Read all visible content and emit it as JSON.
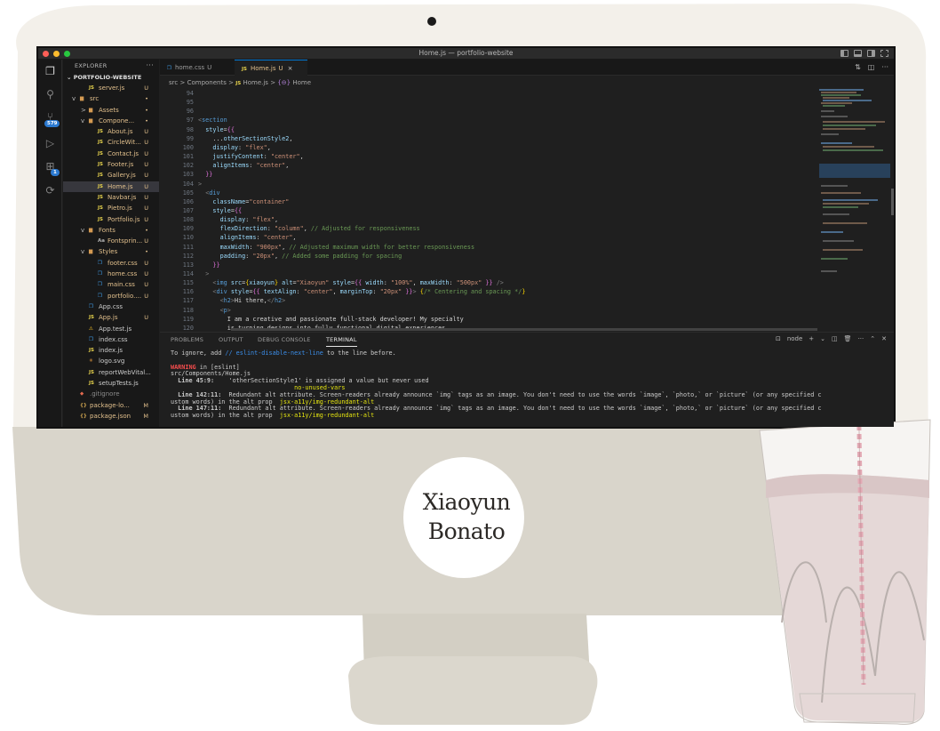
{
  "window": {
    "title": "Home.js — portfolio-website"
  },
  "sidebar": {
    "header": "EXPLORER",
    "more": "···",
    "project": "PORTFOLIO-WEBSITE",
    "activity_badges": {
      "source_control": "579",
      "extensions": "1"
    },
    "items": [
      {
        "chev": "",
        "type": "js",
        "name": "server.js",
        "status": "U",
        "indent": 1
      },
      {
        "chev": "v",
        "type": "folder",
        "name": "src",
        "status": "•",
        "indent": 0
      },
      {
        "chev": ">",
        "type": "folder",
        "name": "Assets",
        "status": "•",
        "indent": 1
      },
      {
        "chev": "v",
        "type": "folder",
        "name": "Compone...",
        "status": "•",
        "indent": 1
      },
      {
        "chev": "",
        "type": "js",
        "name": "About.js",
        "status": "U",
        "indent": 2
      },
      {
        "chev": "",
        "type": "js",
        "name": "CircleWit...",
        "status": "U",
        "indent": 2
      },
      {
        "chev": "",
        "type": "js",
        "name": "Contact.js",
        "status": "U",
        "indent": 2
      },
      {
        "chev": "",
        "type": "js",
        "name": "Footer.js",
        "status": "U",
        "indent": 2
      },
      {
        "chev": "",
        "type": "js",
        "name": "Gallery.js",
        "status": "U",
        "indent": 2
      },
      {
        "chev": "",
        "type": "js",
        "name": "Home.js",
        "status": "U",
        "indent": 2,
        "selected": true
      },
      {
        "chev": "",
        "type": "js",
        "name": "Navbar.js",
        "status": "U",
        "indent": 2
      },
      {
        "chev": "",
        "type": "js",
        "name": "Pietro.js",
        "status": "U",
        "indent": 2
      },
      {
        "chev": "",
        "type": "js",
        "name": "Portfolio.js",
        "status": "U",
        "indent": 2
      },
      {
        "chev": "v",
        "type": "folder",
        "name": "Fonts",
        "status": "•",
        "indent": 1
      },
      {
        "chev": "",
        "type": "font",
        "name": "Fontsprin...",
        "status": "U",
        "indent": 2
      },
      {
        "chev": "v",
        "type": "folder",
        "name": "Styles",
        "status": "•",
        "indent": 1
      },
      {
        "chev": "",
        "type": "css",
        "name": "footer.css",
        "status": "U",
        "indent": 2
      },
      {
        "chev": "",
        "type": "css",
        "name": "home.css",
        "status": "U",
        "indent": 2
      },
      {
        "chev": "",
        "type": "css",
        "name": "main.css",
        "status": "U",
        "indent": 2
      },
      {
        "chev": "",
        "type": "css",
        "name": "portfolio....",
        "status": "U",
        "indent": 2
      },
      {
        "chev": "",
        "type": "css",
        "name": "App.css",
        "status": "",
        "indent": 1
      },
      {
        "chev": "",
        "type": "js",
        "name": "App.js",
        "status": "U",
        "indent": 1
      },
      {
        "chev": "",
        "type": "test",
        "name": "App.test.js",
        "status": "",
        "indent": 1
      },
      {
        "chev": "",
        "type": "css",
        "name": "index.css",
        "status": "",
        "indent": 1
      },
      {
        "chev": "",
        "type": "js",
        "name": "index.js",
        "status": "",
        "indent": 1
      },
      {
        "chev": "",
        "type": "svg",
        "name": "logo.svg",
        "status": "",
        "indent": 1
      },
      {
        "chev": "",
        "type": "js",
        "name": "reportWebVital...",
        "status": "",
        "indent": 1
      },
      {
        "chev": "",
        "type": "js",
        "name": "setupTests.js",
        "status": "",
        "indent": 1
      },
      {
        "chev": "",
        "type": "git",
        "name": ".gitignore",
        "status": "",
        "indent": 0
      },
      {
        "chev": "",
        "type": "json",
        "name": "package-lo...",
        "status": "M",
        "indent": 0
      },
      {
        "chev": "",
        "type": "json",
        "name": "package.json",
        "status": "M",
        "indent": 0
      }
    ]
  },
  "tabs": [
    {
      "type": "CSS",
      "label": "home.css",
      "status": "U",
      "active": false
    },
    {
      "type": "JS",
      "label": "Home.js",
      "status": "U",
      "active": true,
      "close": "×"
    }
  ],
  "breadcrumb": {
    "parts": [
      "src",
      "Components",
      "Home.js",
      "Home"
    ],
    "sep": ">",
    "js_icon": "JS",
    "symbol_icon": "{⊖}"
  },
  "code_lines": [
    {
      "n": "94",
      "segs": []
    },
    {
      "n": "95",
      "segs": []
    },
    {
      "n": "96",
      "segs": []
    },
    {
      "n": "97",
      "segs": [
        [
          "tk-punc",
          "<"
        ],
        [
          "tk-tag",
          "section"
        ]
      ]
    },
    {
      "n": "98",
      "segs": [
        [
          "tk-txt",
          "  "
        ],
        [
          "tk-attr",
          "style"
        ],
        [
          "tk-txt",
          "="
        ],
        [
          "tk-brace",
          "{{"
        ]
      ]
    },
    {
      "n": "99",
      "segs": [
        [
          "tk-txt",
          "    ..."
        ],
        [
          "tk-var",
          "otherSectionStyle2"
        ],
        [
          "tk-txt",
          ","
        ]
      ]
    },
    {
      "n": "100",
      "segs": [
        [
          "tk-txt",
          "    "
        ],
        [
          "tk-var",
          "display"
        ],
        [
          "tk-txt",
          ": "
        ],
        [
          "tk-str",
          "\"flex\""
        ],
        [
          "tk-txt",
          ","
        ]
      ]
    },
    {
      "n": "101",
      "segs": [
        [
          "tk-txt",
          "    "
        ],
        [
          "tk-var",
          "justifyContent"
        ],
        [
          "tk-txt",
          ": "
        ],
        [
          "tk-str",
          "\"center\""
        ],
        [
          "tk-txt",
          ","
        ]
      ]
    },
    {
      "n": "102",
      "segs": [
        [
          "tk-txt",
          "    "
        ],
        [
          "tk-var",
          "alignItems"
        ],
        [
          "tk-txt",
          ": "
        ],
        [
          "tk-str",
          "\"center\""
        ],
        [
          "tk-txt",
          ","
        ]
      ]
    },
    {
      "n": "103",
      "segs": [
        [
          "tk-txt",
          "  "
        ],
        [
          "tk-brace",
          "}}"
        ]
      ]
    },
    {
      "n": "104",
      "segs": [
        [
          "tk-punc",
          ">"
        ]
      ]
    },
    {
      "n": "105",
      "segs": [
        [
          "tk-txt",
          "  "
        ],
        [
          "tk-punc",
          "<"
        ],
        [
          "tk-tag",
          "div"
        ]
      ]
    },
    {
      "n": "106",
      "segs": [
        [
          "tk-txt",
          "    "
        ],
        [
          "tk-attr",
          "className"
        ],
        [
          "tk-txt",
          "="
        ],
        [
          "tk-str",
          "\"container\""
        ]
      ]
    },
    {
      "n": "107",
      "segs": [
        [
          "tk-txt",
          "    "
        ],
        [
          "tk-attr",
          "style"
        ],
        [
          "tk-txt",
          "="
        ],
        [
          "tk-brace",
          "{{"
        ]
      ]
    },
    {
      "n": "108",
      "segs": [
        [
          "tk-txt",
          "      "
        ],
        [
          "tk-var",
          "display"
        ],
        [
          "tk-txt",
          ": "
        ],
        [
          "tk-str",
          "\"flex\""
        ],
        [
          "tk-txt",
          ","
        ]
      ]
    },
    {
      "n": "109",
      "segs": [
        [
          "tk-txt",
          "      "
        ],
        [
          "tk-var",
          "flexDirection"
        ],
        [
          "tk-txt",
          ": "
        ],
        [
          "tk-str",
          "\"column\""
        ],
        [
          "tk-txt",
          ", "
        ],
        [
          "tk-cmt",
          "// Adjusted for responsiveness"
        ]
      ]
    },
    {
      "n": "110",
      "segs": [
        [
          "tk-txt",
          "      "
        ],
        [
          "tk-var",
          "alignItems"
        ],
        [
          "tk-txt",
          ": "
        ],
        [
          "tk-str",
          "\"center\""
        ],
        [
          "tk-txt",
          ","
        ]
      ]
    },
    {
      "n": "111",
      "segs": [
        [
          "tk-txt",
          "      "
        ],
        [
          "tk-var",
          "maxWidth"
        ],
        [
          "tk-txt",
          ": "
        ],
        [
          "tk-str",
          "\"900px\""
        ],
        [
          "tk-txt",
          ", "
        ],
        [
          "tk-cmt",
          "// Adjusted maximum width for better responsiveness"
        ]
      ]
    },
    {
      "n": "112",
      "segs": [
        [
          "tk-txt",
          "      "
        ],
        [
          "tk-var",
          "padding"
        ],
        [
          "tk-txt",
          ": "
        ],
        [
          "tk-str",
          "\"20px\""
        ],
        [
          "tk-txt",
          ", "
        ],
        [
          "tk-cmt",
          "// Added some padding for spacing"
        ]
      ]
    },
    {
      "n": "113",
      "segs": [
        [
          "tk-txt",
          "    "
        ],
        [
          "tk-brace",
          "}}"
        ]
      ]
    },
    {
      "n": "114",
      "segs": [
        [
          "tk-txt",
          "  "
        ],
        [
          "tk-punc",
          ">"
        ]
      ]
    },
    {
      "n": "115",
      "segs": [
        [
          "tk-txt",
          "    "
        ],
        [
          "tk-punc",
          "<"
        ],
        [
          "tk-tag",
          "img"
        ],
        [
          "tk-txt",
          " "
        ],
        [
          "tk-attr",
          "src"
        ],
        [
          "tk-txt",
          "="
        ],
        [
          "tk-brace2",
          "{"
        ],
        [
          "tk-var",
          "xiaoyun"
        ],
        [
          "tk-brace2",
          "}"
        ],
        [
          "tk-txt",
          " "
        ],
        [
          "tk-attr",
          "alt"
        ],
        [
          "tk-txt",
          "="
        ],
        [
          "tk-str",
          "\"Xiaoyun\""
        ],
        [
          "tk-txt",
          " "
        ],
        [
          "tk-attr",
          "style"
        ],
        [
          "tk-txt",
          "="
        ],
        [
          "tk-brace",
          "{{"
        ],
        [
          "tk-txt",
          " "
        ],
        [
          "tk-var",
          "width"
        ],
        [
          "tk-txt",
          ": "
        ],
        [
          "tk-str",
          "\"100%\""
        ],
        [
          "tk-txt",
          ", "
        ],
        [
          "tk-var",
          "maxWidth"
        ],
        [
          "tk-txt",
          ": "
        ],
        [
          "tk-str",
          "\"500px\""
        ],
        [
          "tk-txt",
          " "
        ],
        [
          "tk-brace",
          "}}"
        ],
        [
          "tk-txt",
          " "
        ],
        [
          "tk-punc",
          "/>"
        ]
      ]
    },
    {
      "n": "116",
      "segs": [
        [
          "tk-txt",
          "    "
        ],
        [
          "tk-punc",
          "<"
        ],
        [
          "tk-tag",
          "div"
        ],
        [
          "tk-txt",
          " "
        ],
        [
          "tk-attr",
          "style"
        ],
        [
          "tk-txt",
          "="
        ],
        [
          "tk-brace",
          "{{"
        ],
        [
          "tk-txt",
          " "
        ],
        [
          "tk-var",
          "textAlign"
        ],
        [
          "tk-txt",
          ": "
        ],
        [
          "tk-str",
          "\"center\""
        ],
        [
          "tk-txt",
          ", "
        ],
        [
          "tk-var",
          "marginTop"
        ],
        [
          "tk-txt",
          ": "
        ],
        [
          "tk-str",
          "\"20px\""
        ],
        [
          "tk-txt",
          " "
        ],
        [
          "tk-brace",
          "}}"
        ],
        [
          "tk-punc",
          ">"
        ],
        [
          "tk-txt",
          " "
        ],
        [
          "tk-brace2",
          "{"
        ],
        [
          "tk-cmt",
          "/* Centering and spacing */"
        ],
        [
          "tk-brace2",
          "}"
        ]
      ]
    },
    {
      "n": "117",
      "segs": [
        [
          "tk-txt",
          "      "
        ],
        [
          "tk-punc",
          "<"
        ],
        [
          "tk-tag",
          "h2"
        ],
        [
          "tk-punc",
          ">"
        ],
        [
          "tk-txt",
          "Hi there,"
        ],
        [
          "tk-punc",
          "</"
        ],
        [
          "tk-tag",
          "h2"
        ],
        [
          "tk-punc",
          ">"
        ]
      ]
    },
    {
      "n": "118",
      "segs": [
        [
          "tk-txt",
          "      "
        ],
        [
          "tk-punc",
          "<"
        ],
        [
          "tk-tag",
          "p"
        ],
        [
          "tk-punc",
          ">"
        ]
      ]
    },
    {
      "n": "119",
      "segs": [
        [
          "tk-txt",
          "        I am a creative and passionate full-stack developer! My specialty"
        ]
      ]
    },
    {
      "n": "120",
      "segs": [
        [
          "tk-txt",
          "        is turning designs into fully functional digital experiences,"
        ]
      ]
    }
  ],
  "panel": {
    "tabs": [
      "PROBLEMS",
      "OUTPUT",
      "DEBUG CONSOLE",
      "TERMINAL"
    ],
    "active_tab": "TERMINAL",
    "shell": "node",
    "add": "+",
    "more": "···"
  },
  "terminal_lines": [
    [
      [
        "",
        "To ignore, add "
      ],
      [
        "t-blue",
        "// eslint-disable-next-line"
      ],
      [
        "",
        " to the line before."
      ]
    ],
    [
      [
        "",
        ""
      ]
    ],
    [
      [
        "t-warn",
        "WARNING"
      ],
      [
        "",
        " in [eslint]"
      ]
    ],
    [
      [
        "",
        "src/Components/Home.js"
      ]
    ],
    [
      [
        "t-bold",
        "  Line 45:9:"
      ],
      [
        "",
        "    'otherSectionStyle1' is assigned a value but never used"
      ]
    ],
    [
      [
        "",
        "                                  "
      ],
      [
        "t-yellow",
        "no-unused-vars"
      ]
    ],
    [
      [
        "t-bold",
        "  Line 142:11:"
      ],
      [
        "",
        "  Redundant alt attribute. Screen-readers already announce `img` tags as an image. You don't need to use the words `image`, `photo,` or `picture` (or any specified c"
      ]
    ],
    [
      [
        "",
        "ustom words) in the alt prop  "
      ],
      [
        "t-yellow",
        "jsx-a11y/img-redundant-alt"
      ]
    ],
    [
      [
        "t-bold",
        "  Line 147:11:"
      ],
      [
        "",
        "  Redundant alt attribute. Screen-readers already announce `img` tags as an image. You don't need to use the words `image`, `photo,` or `picture` (or any specified c"
      ]
    ],
    [
      [
        "",
        "ustom words) in the alt prop  "
      ],
      [
        "t-yellow",
        "jsx-a11y/img-redundant-alt"
      ]
    ]
  ],
  "badge": {
    "line1": "Xiaoyun",
    "line2": "Bonato"
  }
}
